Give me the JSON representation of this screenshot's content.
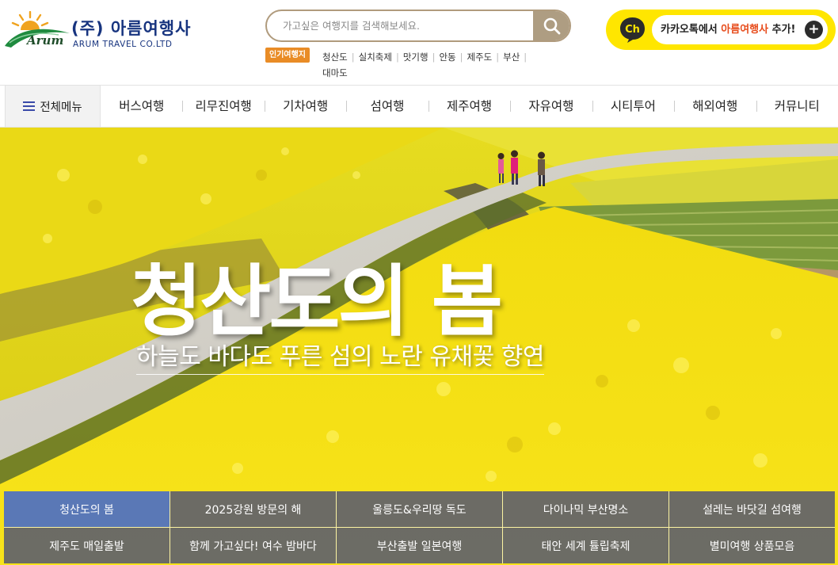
{
  "logo": {
    "name_ko": "(주) 아름여행사",
    "name_en": "ARUM TRAVEL CO.LTD",
    "mark_text": "Arum"
  },
  "search": {
    "placeholder": "가고싶은 여행지를 검색해보세요.",
    "button_icon": "search-icon"
  },
  "popular": {
    "tag": "인기여행지",
    "links": [
      "청산도",
      "실치축제",
      "맛기행",
      "안동",
      "제주도",
      "부산",
      "대마도"
    ]
  },
  "kakao": {
    "icon_label": "Ch",
    "text_prefix": "카카오톡에서 ",
    "text_highlight": "아름여행사",
    "text_suffix": " 추가!",
    "plus": "+",
    "bg_color": "#ffe600",
    "highlight_color": "#e74c1c"
  },
  "nav": {
    "all_menu": "전체메뉴",
    "items": [
      "버스여행",
      "리무진여행",
      "기차여행",
      "섬여행",
      "제주여행",
      "자유여행",
      "시티투어",
      "해외여행",
      "커뮤니티"
    ]
  },
  "hero": {
    "title": "청산도의 봄",
    "subtitle": "하늘도 바다도 푸른 섬의 노란 유채꽃 향연"
  },
  "tabs": {
    "active_index": 0,
    "active_color": "#5a78b6",
    "items": [
      "청산도의 봄",
      "2025강원 방문의 해",
      "울릉도&우리땅 독도",
      "다이나믹 부산명소",
      "설레는 바닷길 섬여행",
      "제주도 매일출발",
      "함께 가고싶다! 여수 밤바다",
      "부산출발 일본여행",
      "태안 세계 튤립축제",
      "별미여행 상품모음"
    ]
  }
}
